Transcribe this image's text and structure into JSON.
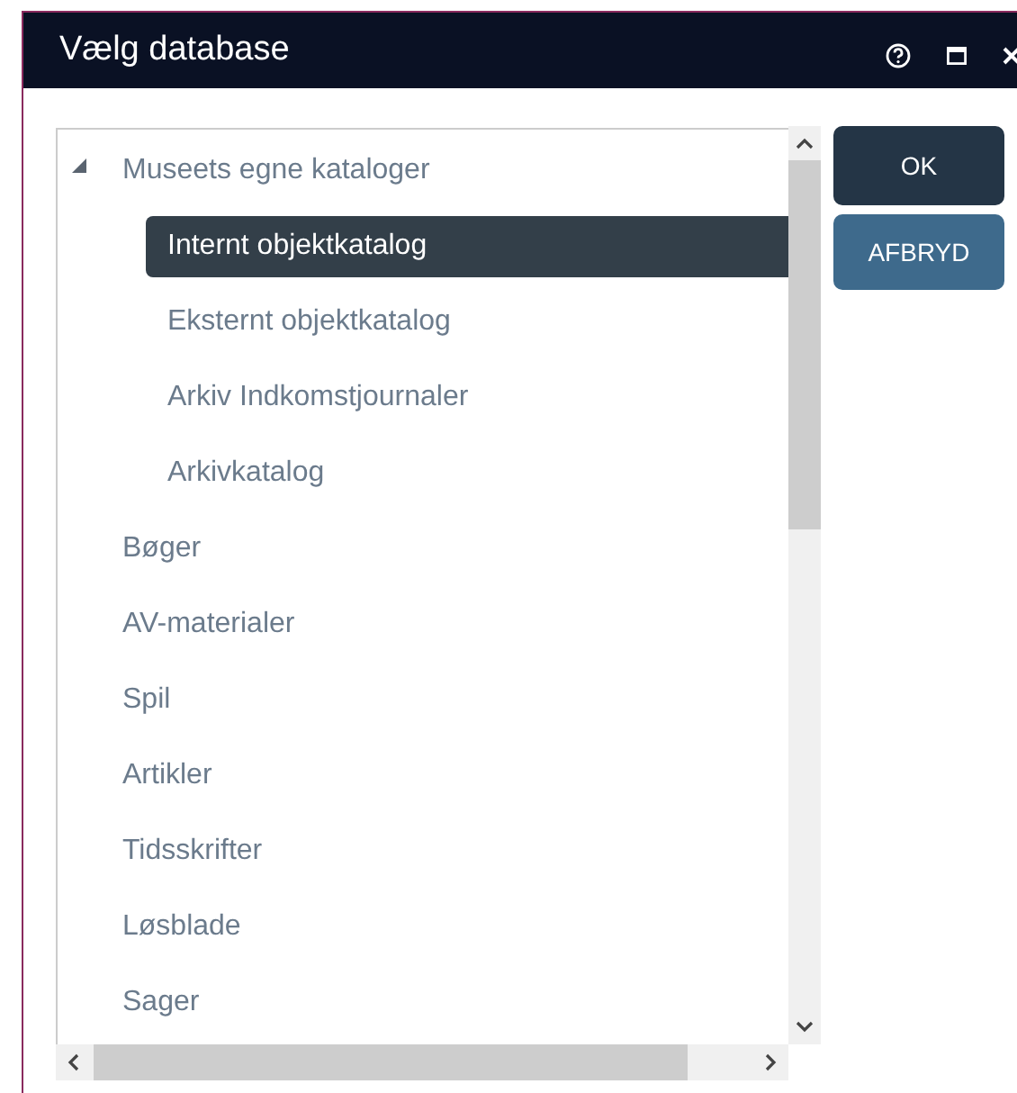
{
  "window": {
    "title": "Vælg database"
  },
  "tree": [
    {
      "label": "Museets egne kataloger",
      "selected": false,
      "expanded": true,
      "children": [
        {
          "label": "Internt objektkatalog",
          "selected": true
        },
        {
          "label": "Eksternt objektkatalog",
          "selected": false
        },
        {
          "label": "Arkiv Indkomstjournaler",
          "selected": false
        },
        {
          "label": "Arkivkatalog",
          "selected": false
        }
      ]
    },
    {
      "label": "Bøger",
      "selected": false
    },
    {
      "label": "AV-materialer",
      "selected": false
    },
    {
      "label": "Spil",
      "selected": false
    },
    {
      "label": "Artikler",
      "selected": false
    },
    {
      "label": "Tidsskrifter",
      "selected": false
    },
    {
      "label": "Løsblade",
      "selected": false
    },
    {
      "label": "Sager",
      "selected": false
    }
  ],
  "buttons": [
    {
      "label": "OK",
      "kind": "primary"
    },
    {
      "label": "AFBRYD",
      "kind": "secondary"
    }
  ]
}
